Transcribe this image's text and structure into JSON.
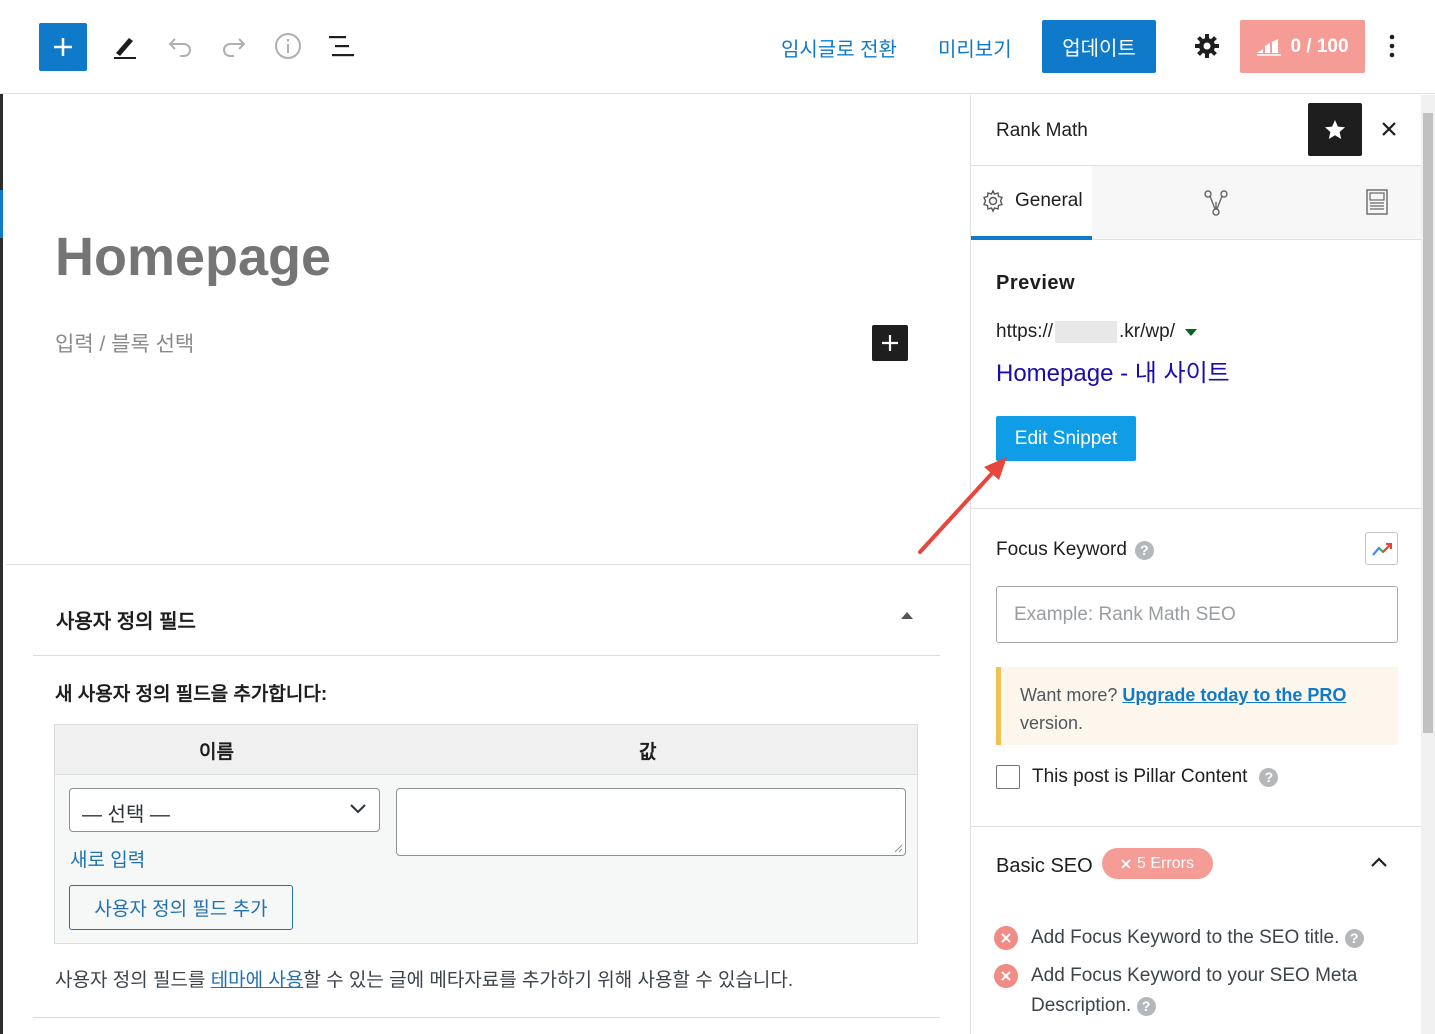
{
  "toolbar": {
    "switch_draft": "임시글로 전환",
    "preview": "미리보기",
    "update": "업데이트",
    "rank_math_score": "0 / 100"
  },
  "editor": {
    "post_title": "Homepage",
    "block_placeholder": "입력 / 블록 선택"
  },
  "custom_fields": {
    "title": "사용자 정의 필드",
    "add_new_label": "새 사용자 정의 필드을 추가합니다:",
    "col_name": "이름",
    "col_value": "값",
    "select_value": "— 선택 —",
    "enter_new": "새로 입력",
    "add_button": "사용자 정의 필드 추가",
    "desc_before": "사용자 정의 필드를 ",
    "desc_link": "테마에 사용",
    "desc_after": "할 수 있는 글에 메타자료를 추가하기 위해 사용할 수 있습니다."
  },
  "sidebar": {
    "title": "Rank Math",
    "tabs": {
      "general": "General"
    },
    "preview_section": {
      "title": "Preview",
      "url_start": "https://",
      "url_end": ".kr/wp/",
      "snippet_title": "Homepage - 내 사이트",
      "edit_snippet": "Edit Snippet"
    },
    "focus_keyword": {
      "label": "Focus Keyword",
      "placeholder": "Example: Rank Math SEO"
    },
    "pro_notice": {
      "text": "Want more? ",
      "link": "Upgrade today to the PRO",
      "suffix": "version."
    },
    "pillar": {
      "label": "This post is Pillar Content"
    },
    "basic_seo": {
      "title": "Basic SEO",
      "errors": "5 Errors",
      "items": [
        "Add Focus Keyword to the SEO title.",
        "Add Focus Keyword to your SEO Meta Description."
      ]
    }
  },
  "colors": {
    "primary": "#0f7ac9",
    "rank_math_red": "#f59c97",
    "snippet_blue": "#1a0dab",
    "annotation_arrow": "#e8453c"
  }
}
